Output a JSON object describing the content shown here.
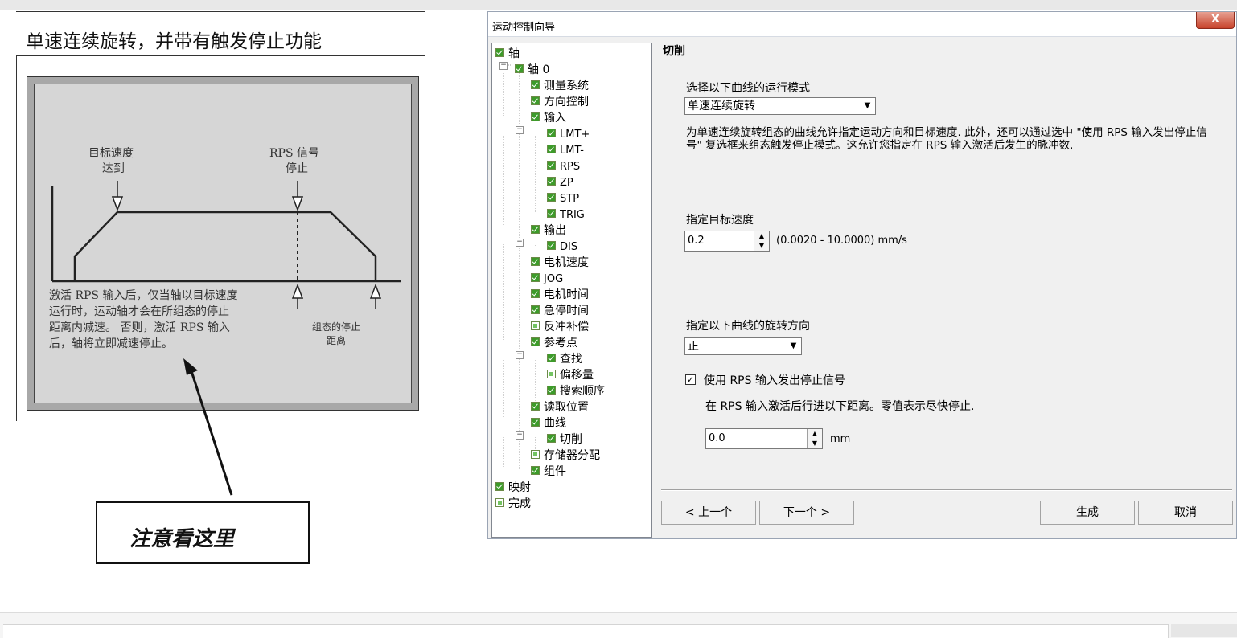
{
  "doc": {
    "title": "单速连续旋转，并带有触发停止功能",
    "figure": {
      "label_target_speed_1": "目标速度",
      "label_target_speed_2": "达到",
      "label_rps_1": "RPS 信号",
      "label_rps_2": "停止",
      "desc_lines": [
        "激活 RPS 输入后，仅当轴以目标速度",
        "运行时，运动轴才会在所组态的停止",
        "距离内减速。  否则，激活 RPS 输入",
        "后，轴将立即减速停止。"
      ],
      "label_stop_dist_1": "组态的停止",
      "label_stop_dist_2": "距离"
    },
    "note": "注意看这里"
  },
  "dialog": {
    "title": "运动控制向导",
    "close_label": "X",
    "tree": [
      {
        "label": "轴",
        "state": "on"
      },
      {
        "label": "轴 0",
        "state": "on"
      },
      {
        "label": "测量系统",
        "state": "on"
      },
      {
        "label": "方向控制",
        "state": "on"
      },
      {
        "label": "输入",
        "state": "on"
      },
      {
        "label": "LMT+",
        "state": "on"
      },
      {
        "label": "LMT-",
        "state": "on"
      },
      {
        "label": "RPS",
        "state": "on"
      },
      {
        "label": "ZP",
        "state": "on"
      },
      {
        "label": "STP",
        "state": "on"
      },
      {
        "label": "TRIG",
        "state": "on"
      },
      {
        "label": "输出",
        "state": "on"
      },
      {
        "label": "DIS",
        "state": "on"
      },
      {
        "label": "电机速度",
        "state": "on"
      },
      {
        "label": "JOG",
        "state": "on"
      },
      {
        "label": "电机时间",
        "state": "on"
      },
      {
        "label": "急停时间",
        "state": "on"
      },
      {
        "label": "反冲补偿",
        "state": "part"
      },
      {
        "label": "参考点",
        "state": "on"
      },
      {
        "label": "查找",
        "state": "on"
      },
      {
        "label": "偏移量",
        "state": "part"
      },
      {
        "label": "搜索顺序",
        "state": "on"
      },
      {
        "label": "读取位置",
        "state": "on"
      },
      {
        "label": "曲线",
        "state": "on"
      },
      {
        "label": "切削",
        "state": "on"
      },
      {
        "label": "存储器分配",
        "state": "part"
      },
      {
        "label": "组件",
        "state": "on"
      },
      {
        "label": "映射",
        "state": "on"
      },
      {
        "label": "完成",
        "state": "part"
      }
    ],
    "section_title": "切削",
    "mode_label": "选择以下曲线的运行模式",
    "mode_value": "单速连续旋转",
    "description": "为单速连续旋转组态的曲线允许指定运动方向和目标速度. 此外，还可以通过选中 \"使用 RPS 输入发出停止信号\" 复选框来组态触发停止模式。这允许您指定在 RPS 输入激活后发生的脉冲数.",
    "speed_label": "指定目标速度",
    "speed_value": "0.2",
    "speed_range": "(0.0020 - 10.0000) mm/s",
    "direction_label": "指定以下曲线的旋转方向",
    "direction_value": "正",
    "rps_checkbox_label": "使用 RPS 输入发出停止信号",
    "rps_checked": true,
    "rps_distance_label": "在 RPS 输入激活后行进以下距离。零值表示尽快停止.",
    "distance_value": "0.0",
    "distance_unit": "mm",
    "buttons": {
      "prev": "< 上一个",
      "next": "下一个 >",
      "generate": "生成",
      "cancel": "取消"
    }
  }
}
